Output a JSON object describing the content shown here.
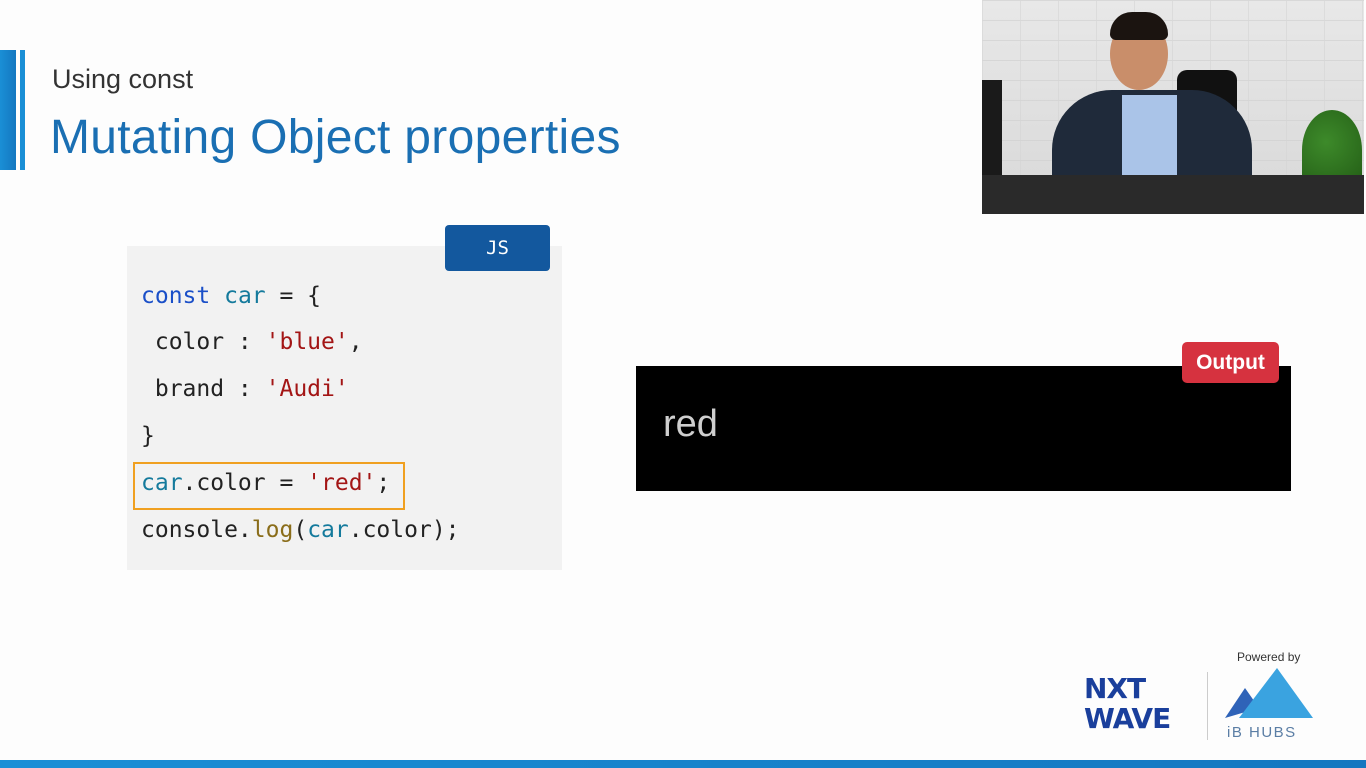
{
  "slide": {
    "subtitle": "Using const",
    "title": "Mutating Object properties"
  },
  "code": {
    "badge": "JS",
    "lines": [
      [
        {
          "t": "const ",
          "c": "kw"
        },
        {
          "t": "car",
          "c": "var"
        },
        {
          "t": " = {",
          "c": ""
        }
      ],
      [
        {
          "t": " color : ",
          "c": ""
        },
        {
          "t": "'blue'",
          "c": "str"
        },
        {
          "t": ",",
          "c": ""
        }
      ],
      [
        {
          "t": " brand : ",
          "c": ""
        },
        {
          "t": "'Audi'",
          "c": "str"
        }
      ],
      [
        {
          "t": "}",
          "c": ""
        }
      ],
      [
        {
          "t": "car",
          "c": "var"
        },
        {
          "t": ".color = ",
          "c": ""
        },
        {
          "t": "'red'",
          "c": "str"
        },
        {
          "t": ";",
          "c": ""
        }
      ],
      [
        {
          "t": "console.",
          "c": ""
        },
        {
          "t": "log",
          "c": "fn"
        },
        {
          "t": "(",
          "c": ""
        },
        {
          "t": "car",
          "c": "var"
        },
        {
          "t": ".color);",
          "c": ""
        }
      ]
    ],
    "highlighted_line": 4
  },
  "output": {
    "badge": "Output",
    "text": "red"
  },
  "branding": {
    "powered_by": "Powered by",
    "logo_line1": "NXT",
    "logo_line2": "WAVE",
    "partner": "iB HUBS"
  },
  "colors": {
    "accent": "#1a6fb3",
    "js_badge": "#13589e",
    "output_badge": "#d6323f",
    "highlight": "#f0a020"
  }
}
